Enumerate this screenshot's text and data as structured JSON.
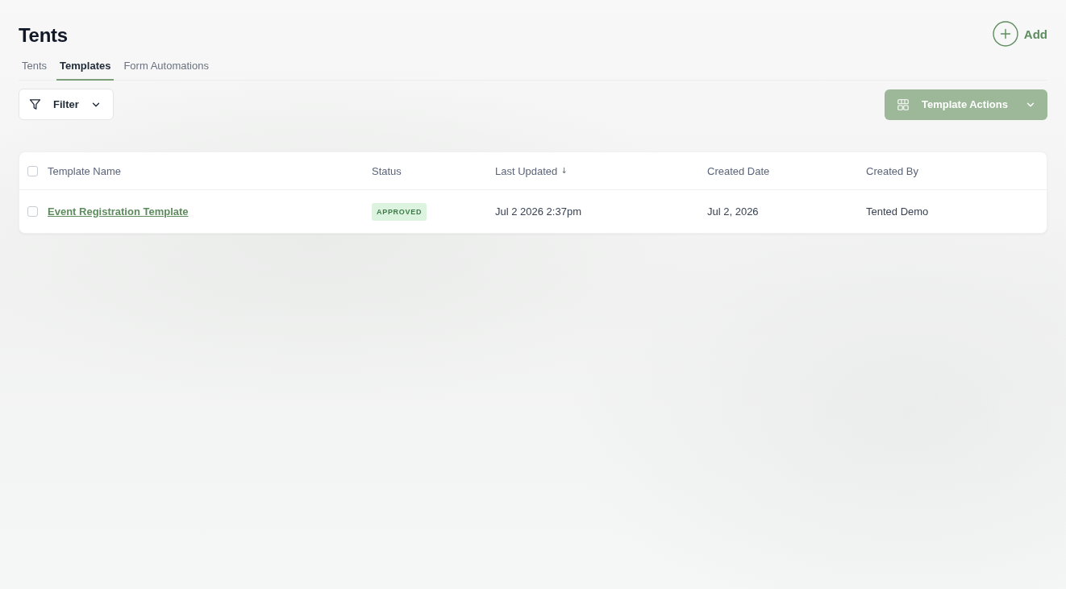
{
  "page": {
    "title": "Tents"
  },
  "add_button": {
    "label": "Add"
  },
  "tabs": [
    {
      "label": "Tents",
      "selected": false
    },
    {
      "label": "Templates",
      "selected": true
    },
    {
      "label": "Form Automations",
      "selected": false
    }
  ],
  "filter_button": {
    "label": "Filter"
  },
  "actions_button": {
    "label": "Template Actions",
    "disabled": true
  },
  "table": {
    "select_all": {
      "checked": false
    },
    "columns": [
      {
        "label": "Template Name"
      },
      {
        "label": "Status"
      },
      {
        "label": "Last Updated",
        "sort_arrow": "↓"
      },
      {
        "label": "Created Date"
      },
      {
        "label": "Created By"
      }
    ],
    "rows": [
      {
        "checked": false,
        "name": "Event Registration Template",
        "status": "APPROVED",
        "last_updated": "Jul 2 2026 2:37pm",
        "created_date": "Jul 2, 2026",
        "created_by": "Tented Demo"
      }
    ]
  }
}
